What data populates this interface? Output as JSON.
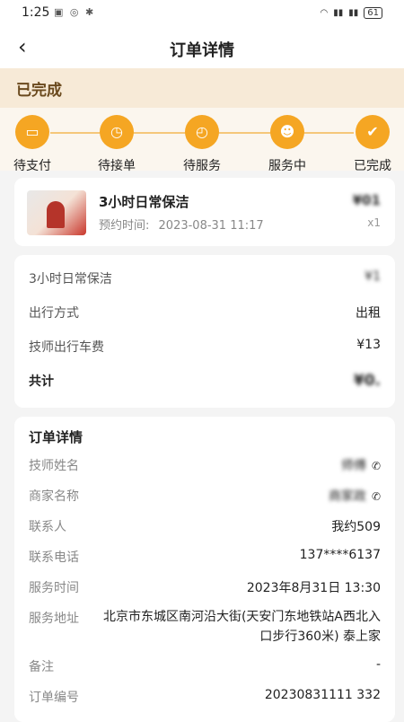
{
  "status_bar": {
    "time": "1:25",
    "battery": "61"
  },
  "nav": {
    "title": "订单详情"
  },
  "order_status": "已完成",
  "steps": [
    {
      "label": "待支付"
    },
    {
      "label": "待接单"
    },
    {
      "label": "待服务"
    },
    {
      "label": "服务中"
    },
    {
      "label": "已完成"
    }
  ],
  "service": {
    "name": "3小时日常保洁",
    "appointment_label": "预约时间:",
    "appointment_time": "2023-08-31 11:17",
    "price": "¥01",
    "quantity": "x1"
  },
  "fees": {
    "service_label": "3小时日常保洁",
    "service_value": "¥1",
    "travel_mode_label": "出行方式",
    "travel_mode_value": "出租",
    "car_fee_label": "技师出行车费",
    "car_fee_value": "¥13",
    "total_label": "共计",
    "total_value": "¥0."
  },
  "details": {
    "title": "订单详情",
    "technician_label": "技师姓名",
    "technician_value": "师傅",
    "merchant_label": "商家名称",
    "merchant_value": "商家政",
    "contact_label": "联系人",
    "contact_value": "我约509",
    "phone_label": "联系电话",
    "phone_value": "137****6137",
    "service_time_label": "服务时间",
    "service_time_value": "2023年8月31日 13:30",
    "address_label": "服务地址",
    "address_value": "北京市东城区南河沿大街(天安门东地铁站A西北入口步行360米) 泰上家",
    "note_label": "备注",
    "note_value": "-",
    "order_no_label": "订单编号",
    "order_no_value": "20230831111 332"
  }
}
